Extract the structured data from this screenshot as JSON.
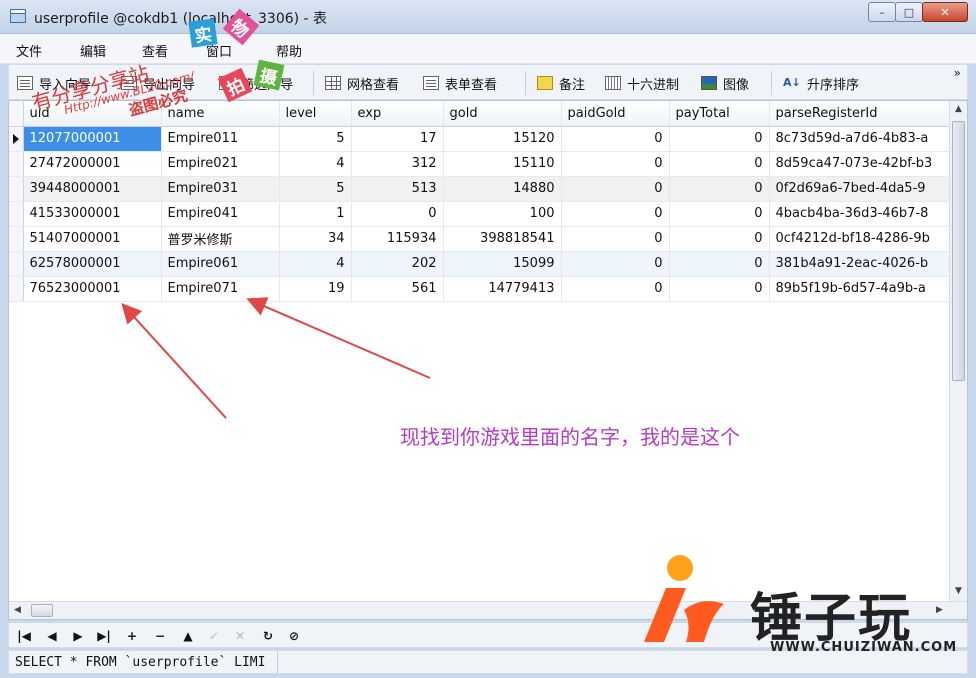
{
  "window": {
    "title": "userprofile @cokdb1 (localhost_3306) - 表",
    "controls": [
      "–",
      "□",
      "✕"
    ]
  },
  "menu": [
    "文件",
    "编辑",
    "查看",
    "窗口",
    "帮助"
  ],
  "toolbar": {
    "import_label": "导入向导",
    "export_label": "导出向导",
    "filter_label": "筛选向导",
    "grid_view_label": "网格查看",
    "form_view_label": "表单查看",
    "note_label": "备注",
    "hex_label": "十六进制",
    "image_label": "图像",
    "sort_label": "升序排序",
    "more": "»"
  },
  "grid": {
    "columns": [
      "uid",
      "name",
      "level",
      "exp",
      "gold",
      "paidGold",
      "payTotal",
      "parseRegisterId"
    ],
    "rows": [
      [
        "12077000001",
        "Empire011",
        "5",
        "17",
        "15120",
        "0",
        "0",
        "8c73d59d-a7d6-4b83-a"
      ],
      [
        "27472000001",
        "Empire021",
        "4",
        "312",
        "15110",
        "0",
        "0",
        "8d59ca47-073e-42bf-b3"
      ],
      [
        "39448000001",
        "Empire031",
        "5",
        "513",
        "14880",
        "0",
        "0",
        "0f2d69a6-7bed-4da5-9"
      ],
      [
        "41533000001",
        "Empire041",
        "1",
        "0",
        "100",
        "0",
        "0",
        "4bacb4ba-36d3-46b7-8"
      ],
      [
        "51407000001",
        "普罗米修斯",
        "34",
        "115934",
        "398818541",
        "0",
        "0",
        "0cf4212d-bf18-4286-9b"
      ],
      [
        "62578000001",
        "Empire061",
        "4",
        "202",
        "15099",
        "0",
        "0",
        "381b4a91-2eac-4026-b"
      ],
      [
        "76523000001",
        "Empire071",
        "19",
        "561",
        "14779413",
        "0",
        "0",
        "89b5f19b-6d57-4a9b-a"
      ]
    ]
  },
  "navigation": {
    "buttons": [
      "first",
      "prev",
      "next",
      "last",
      "add",
      "delete",
      "up",
      "apply",
      "cancel",
      "refresh",
      "stop"
    ]
  },
  "status": {
    "sql": "SELECT * FROM `userprofile` LIMI"
  },
  "annotation": {
    "text": "现找到你游戏里面的名字，我的是这个"
  },
  "watermark": {
    "line1": "有分享分享站",
    "url": "Http://www.BL20.com/",
    "line2": "盗图必究",
    "tiles": [
      "实",
      "物",
      "拍",
      "摄"
    ]
  },
  "logo": {
    "brand": "锤子玩",
    "site": "WWW.CHUIZIWAN.COM"
  },
  "colors": {
    "selected_cell": "#3d8ee6",
    "annotation": "#b43cc4",
    "arrow": "#e04747",
    "logo_orange": "#ff5a1f"
  }
}
